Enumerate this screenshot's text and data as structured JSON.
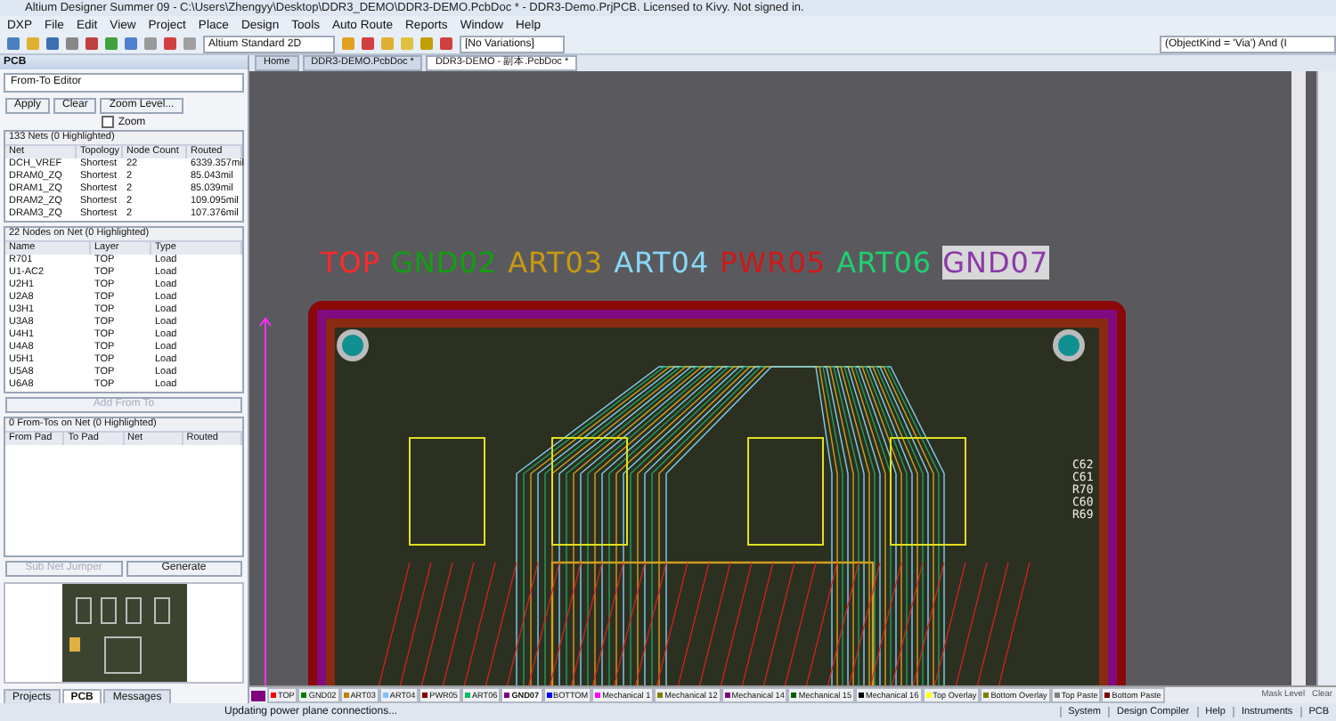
{
  "window": {
    "title": "Altium Designer Summer 09 - C:\\Users\\Zhengyy\\Desktop\\DDR3_DEMO\\DDR3-DEMO.PcbDoc * - DDR3-Demo.PrjPCB. Licensed to Kivy. Not signed in."
  },
  "menu": [
    "DXP",
    "File",
    "Edit",
    "View",
    "Project",
    "Place",
    "Design",
    "Tools",
    "Auto Route",
    "Reports",
    "Window",
    "Help"
  ],
  "toolbar": {
    "view_mode": "Altium Standard 2D",
    "variations": "[No Variations]",
    "filter": "(ObjectKind = 'Via') And (I"
  },
  "panel": {
    "title": "PCB",
    "mode": "From-To Editor",
    "buttons": [
      "Apply",
      "Clear",
      "Zoom Level..."
    ],
    "zoom": {
      "label": "Zoom",
      "checked": false
    },
    "nets": {
      "header": "133 Nets (0 Highlighted)",
      "columns": [
        "Net",
        "Topology",
        "Node Count",
        "Routed"
      ],
      "rows": [
        [
          "DCH_VREF",
          "Shortest",
          "22",
          "6339.357mil"
        ],
        [
          "DRAM0_ZQ",
          "Shortest",
          "2",
          "85.043mil"
        ],
        [
          "DRAM1_ZQ",
          "Shortest",
          "2",
          "85.039mil"
        ],
        [
          "DRAM2_ZQ",
          "Shortest",
          "2",
          "109.095mil"
        ],
        [
          "DRAM3_ZQ",
          "Shortest",
          "2",
          "107.376mil"
        ]
      ]
    },
    "nodes": {
      "header": "22 Nodes on Net (0 Highlighted)",
      "columns": [
        "Name",
        "Layer",
        "Type"
      ],
      "rows": [
        [
          "R701",
          "TOP",
          "Load"
        ],
        [
          "U1-AC2",
          "TOP",
          "Load"
        ],
        [
          "U2H1",
          "TOP",
          "Load"
        ],
        [
          "U2A8",
          "TOP",
          "Load"
        ],
        [
          "U3H1",
          "TOP",
          "Load"
        ],
        [
          "U3A8",
          "TOP",
          "Load"
        ],
        [
          "U4H1",
          "TOP",
          "Load"
        ],
        [
          "U4A8",
          "TOP",
          "Load"
        ],
        [
          "U5H1",
          "TOP",
          "Load"
        ],
        [
          "U5A8",
          "TOP",
          "Load"
        ],
        [
          "U6A8",
          "TOP",
          "Load"
        ]
      ]
    },
    "add_button": "Add From To",
    "fromtos": {
      "header": "0 From-Tos on Net (0 Highlighted)",
      "columns": [
        "From Pad",
        "To Pad",
        "Net",
        "Routed"
      ]
    },
    "sub_buttons": [
      {
        "label": "Sub Net Jumper",
        "disabled": true
      },
      {
        "label": "Generate",
        "disabled": false
      }
    ],
    "tabs": [
      {
        "label": "Projects",
        "selected": false
      },
      {
        "label": "PCB",
        "selected": true
      },
      {
        "label": "Messages",
        "selected": false
      }
    ]
  },
  "documents": [
    {
      "label": "Home",
      "selected": false
    },
    {
      "label": "DDR3-DEMO.PcbDoc *",
      "selected": false
    },
    {
      "label": "DDR3-DEMO - 副本.PcbDoc *",
      "selected": true
    }
  ],
  "canvas": {
    "layer_labels": [
      {
        "text": "TOP",
        "color": "#ff2a2a"
      },
      {
        "text": "GND02",
        "color": "#10a010"
      },
      {
        "text": "ART03",
        "color": "#c89a10"
      },
      {
        "text": "ART04",
        "color": "#88d8f8"
      },
      {
        "text": "PWR05",
        "color": "#d01818"
      },
      {
        "text": "ART06",
        "color": "#20d070"
      },
      {
        "text": "GND07",
        "color": "#8a3aa8"
      }
    ],
    "designators": [
      "C62",
      "C61",
      "R70",
      "C60",
      "R69"
    ]
  },
  "layers": [
    {
      "label": "TOP",
      "color": "#ff0000",
      "selected": false
    },
    {
      "label": "GND02",
      "color": "#008000",
      "selected": false
    },
    {
      "label": "ART03",
      "color": "#c08000",
      "selected": false
    },
    {
      "label": "ART04",
      "color": "#80c0ff",
      "selected": false
    },
    {
      "label": "PWR05",
      "color": "#800000",
      "selected": false
    },
    {
      "label": "ART06",
      "color": "#00c060",
      "selected": false
    },
    {
      "label": "GND07",
      "color": "#800080",
      "selected": true
    },
    {
      "label": "BOTTOM",
      "color": "#0000ff",
      "selected": false
    },
    {
      "label": "Mechanical 1",
      "color": "#ff00ff",
      "selected": false
    },
    {
      "label": "Mechanical 12",
      "color": "#808000",
      "selected": false
    },
    {
      "label": "Mechanical 14",
      "color": "#800080",
      "selected": false
    },
    {
      "label": "Mechanical 15",
      "color": "#006000",
      "selected": false
    },
    {
      "label": "Mechanical 16",
      "color": "#000000",
      "selected": false
    },
    {
      "label": "Top Overlay",
      "color": "#ffff00",
      "selected": false
    },
    {
      "label": "Bottom Overlay",
      "color": "#808000",
      "selected": false
    },
    {
      "label": "Top Paste",
      "color": "#808080",
      "selected": false
    },
    {
      "label": "Bottom Paste",
      "color": "#800000",
      "selected": false
    }
  ],
  "layer_actions": [
    "Mask Level",
    "Clear"
  ],
  "status_bar": {
    "message": "Updating power plane connections...",
    "buttons": [
      "System",
      "Design Compiler",
      "Help",
      "Instruments",
      "PCB"
    ]
  }
}
